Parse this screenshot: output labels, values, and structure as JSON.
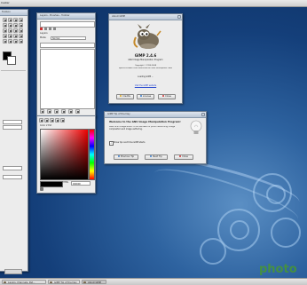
{
  "top_menu": {
    "label": "Cester"
  },
  "toolbox": {
    "title": "Toolbox"
  },
  "layers": {
    "title": "Layers - Brushes - Toolbar",
    "mode_label": "Mode:",
    "mode_value": "Normal",
    "layer_label": "Layers"
  },
  "fg_color": {
    "title": "Color 2 Ext",
    "hex_label": "HTML",
    "hex_value": "000000"
  },
  "about": {
    "title": "About GIMP",
    "app_name": "GIMP 2.4.6",
    "subtitle": "GNU Image Manipulation Program",
    "copyright": "Copyright © 1995-2008",
    "authors": "Spencer Kimball, Peter Mattis and the GIMP Development Team",
    "loading": "Loading GIMP ...",
    "url": "Visit the GIMP website",
    "credits_label": "Credits",
    "license_label": "License",
    "close_label": "Close"
  },
  "tip": {
    "title": "GIMP Tip of the Day",
    "heading": "Welcome to the GNU Image Manipulation Program!",
    "body": "GIMP is an image editor. It can be used for photo retouching, image composition and image authoring.",
    "checkbox_label": "Show tip next time GIMP starts",
    "checked": true,
    "prev_label": "Previous Tip",
    "next_label": "Next Tip",
    "close_label": "Close"
  },
  "taskbar": {
    "items": [
      "Layers, Channels, Pat...",
      "GIMP Tip of the Day",
      "About GIMP"
    ]
  },
  "watermark": {
    "text": "photo"
  },
  "colors": {
    "desktop": "#1a4a87",
    "title_bar": "#c8d3e0",
    "accent_green": "#4a9a2a"
  }
}
